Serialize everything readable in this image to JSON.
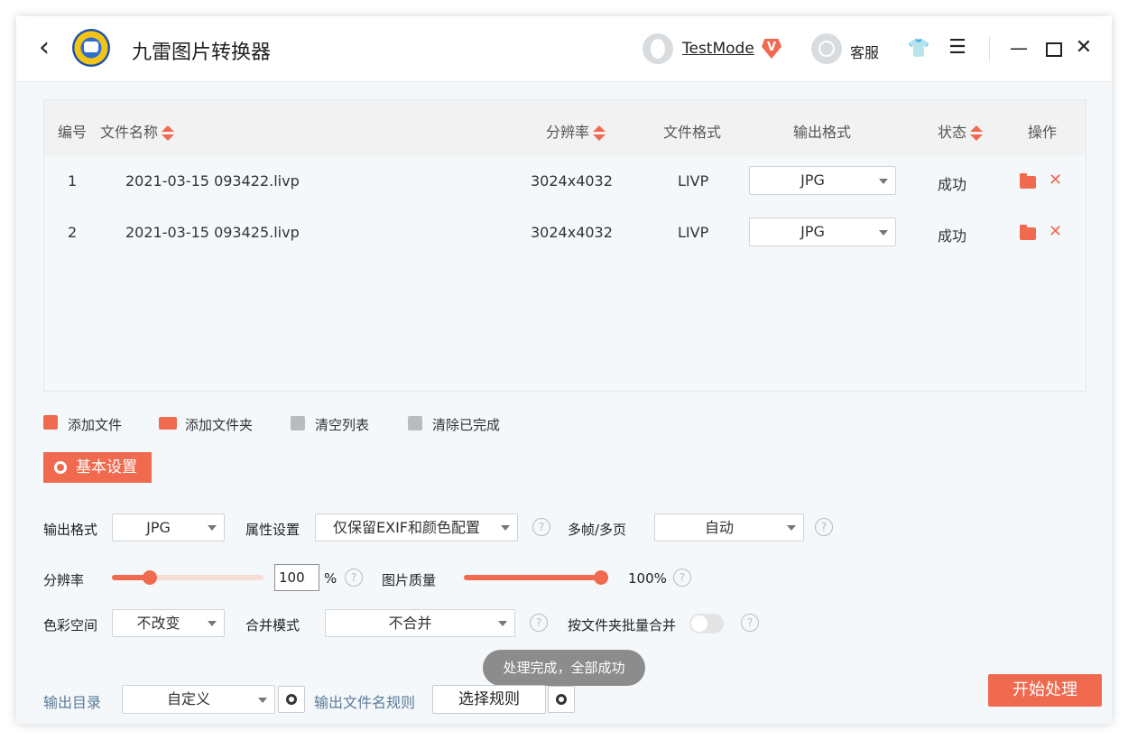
{
  "app": {
    "title": "九雷图片转换器",
    "user_name": "TestMode",
    "vip_badge": "V",
    "service_label": "客服",
    "accent_color": "#f06a50"
  },
  "table": {
    "headers": {
      "index": "编号",
      "filename": "文件名称",
      "resolution": "分辨率",
      "file_format": "文件格式",
      "output_format": "输出格式",
      "status": "状态",
      "actions": "操作"
    },
    "rows": [
      {
        "index": "1",
        "filename": "2021-03-15 093422.livp",
        "resolution": "3024x4032",
        "file_format": "LIVP",
        "output_format": "JPG",
        "status": "成功"
      },
      {
        "index": "2",
        "filename": "2021-03-15 093425.livp",
        "resolution": "3024x4032",
        "file_format": "LIVP",
        "output_format": "JPG",
        "status": "成功"
      }
    ]
  },
  "toolbar": {
    "add_file": "添加文件",
    "add_folder": "添加文件夹",
    "clear_list": "清空列表",
    "clear_done": "清除已完成"
  },
  "settings": {
    "basic_label": "基本设置",
    "output_format_label": "输出格式",
    "output_format_value": "JPG",
    "attr_label": "属性设置",
    "attr_value": "仅保留EXIF和颜色配置",
    "multiframe_label": "多帧/多页",
    "multiframe_value": "自动",
    "resolution_label": "分辨率",
    "resolution_value": "100",
    "resolution_unit": "%",
    "resolution_slider_fraction": 0.25,
    "quality_label": "图片质量",
    "quality_value": "100%",
    "quality_fraction": 1.0,
    "color_space_label": "色彩空间",
    "color_space_value": "不改变",
    "merge_mode_label": "合并模式",
    "merge_mode_value": "不合并",
    "folder_merge_label": "按文件夹批量合并",
    "folder_merge_on": false,
    "help_glyph": "?"
  },
  "toast": "处理完成，全部成功",
  "footer": {
    "output_dir_label": "输出目录",
    "output_dir_value": "自定义",
    "filename_rule_label": "输出文件名规则",
    "choose_rule_label": "选择规则",
    "start_label": "开始处理"
  }
}
